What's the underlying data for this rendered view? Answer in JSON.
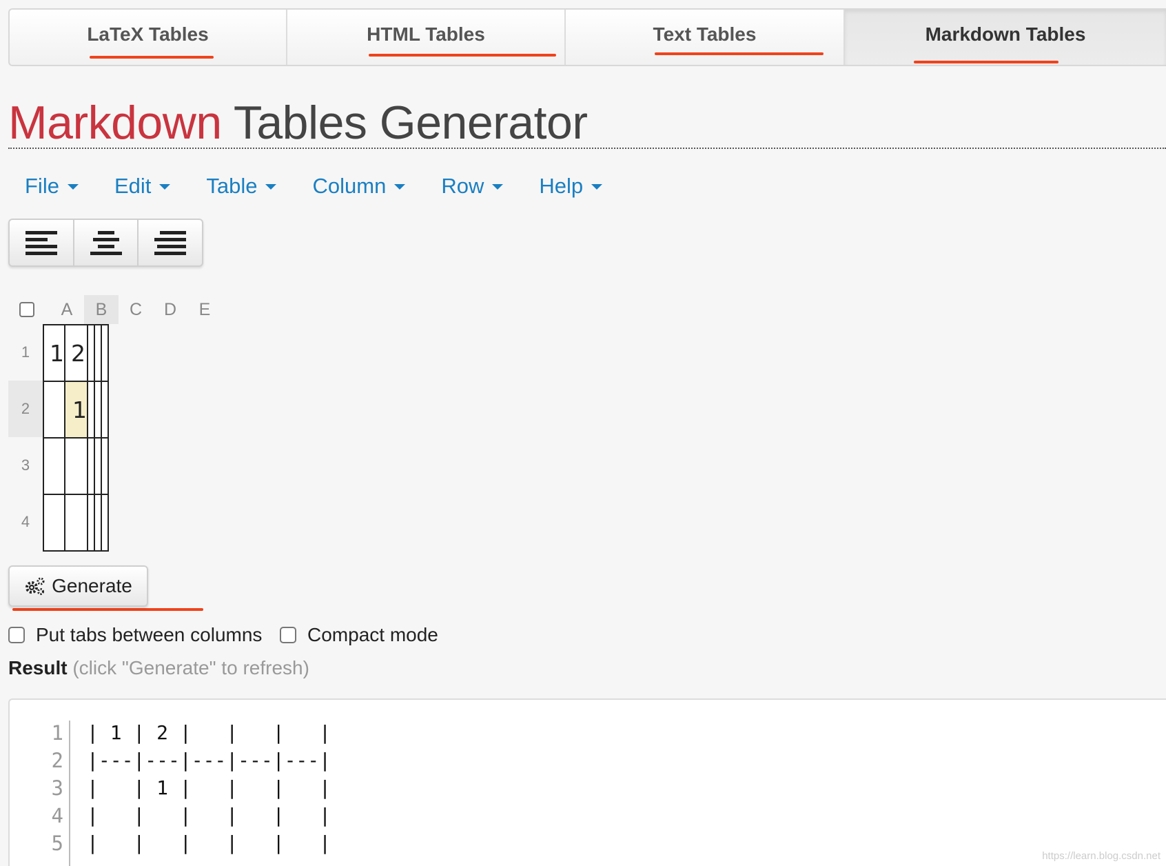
{
  "tabs": [
    {
      "label": "LaTeX Tables",
      "active": false
    },
    {
      "label": "HTML Tables",
      "active": false
    },
    {
      "label": "Text Tables",
      "active": false
    },
    {
      "label": "Markdown Tables",
      "active": true
    }
  ],
  "title": {
    "accent": "Markdown",
    "rest": "Tables Generator"
  },
  "menu": [
    "File",
    "Edit",
    "Table",
    "Column",
    "Row",
    "Help"
  ],
  "toolbar": {
    "align_buttons": [
      "align-left-icon",
      "align-center-icon",
      "align-right-icon"
    ]
  },
  "grid": {
    "columns": [
      "A",
      "B",
      "C",
      "D",
      "E"
    ],
    "rows": [
      "1",
      "2",
      "3",
      "4"
    ],
    "cells": [
      [
        "1",
        "2",
        "",
        "",
        ""
      ],
      [
        "",
        "1",
        "",
        "",
        ""
      ],
      [
        "",
        "",
        "",
        "",
        ""
      ],
      [
        "",
        "",
        "",
        "",
        ""
      ]
    ],
    "selected_column": "B",
    "selected_row": "2",
    "highlight_color": "#f5eec9"
  },
  "generate": {
    "label": "Generate"
  },
  "options": {
    "tabs_label": "Put tabs between columns",
    "compact_label": "Compact mode"
  },
  "result": {
    "label": "Result",
    "hint": "(click \"Generate\" to refresh)",
    "line_numbers": [
      "1",
      "2",
      "3",
      "4",
      "5"
    ],
    "lines": [
      "| 1 | 2 |   |   |   |",
      "|---|---|---|---|---|",
      "|   | 1 |   |   |   |",
      "|   |   |   |   |   |",
      "|   |   |   |   |   |"
    ]
  },
  "watermark": "https://learn.blog.csdn.net",
  "colors": {
    "accent_red": "#c9343f",
    "menu_blue": "#1a7fc2",
    "annotation_red": "#f0421b"
  }
}
